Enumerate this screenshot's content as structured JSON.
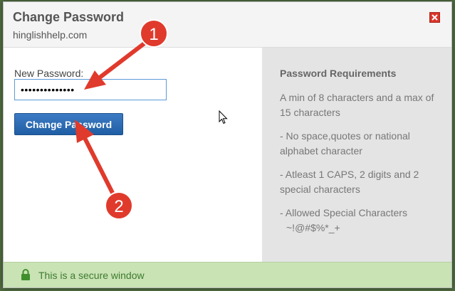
{
  "dialog": {
    "title": "Change Password",
    "subtitle": "hinglishhelp.com"
  },
  "form": {
    "label": "New Password:",
    "password_value": "••••••••••••••",
    "submit_label": "Change Password"
  },
  "requirements": {
    "title": "Password Requirements",
    "items": [
      "A min of 8 characters and a max of 15 characters",
      "- No space,quotes or national alphabet character",
      "- Atleast 1 CAPS, 2 digits and 2 special characters",
      "- Allowed Special Characters"
    ],
    "special_chars": "~!@#$%*_+"
  },
  "footer": {
    "secure_text": "This is a secure window"
  },
  "annotations": [
    {
      "number": "1"
    },
    {
      "number": "2"
    }
  ],
  "icons": {
    "close": "close-icon",
    "lock": "lock-icon",
    "cursor": "cursor-icon"
  },
  "colors": {
    "button": "#2a6cb6",
    "close": "#d9362a",
    "footer_bg": "#c9e3b5",
    "footer_text": "#3e7a2e",
    "annotation": "#e03a2c",
    "requirements_bg": "#e4e4e4"
  }
}
